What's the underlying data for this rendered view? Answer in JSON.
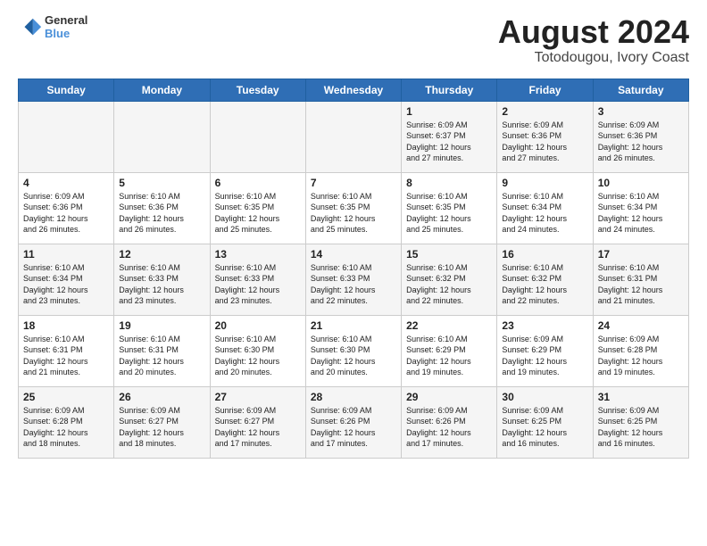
{
  "logo": {
    "line1": "General",
    "line2": "Blue"
  },
  "title": "August 2024",
  "subtitle": "Totodougou, Ivory Coast",
  "days_of_week": [
    "Sunday",
    "Monday",
    "Tuesday",
    "Wednesday",
    "Thursday",
    "Friday",
    "Saturday"
  ],
  "weeks": [
    [
      {
        "day": "",
        "info": ""
      },
      {
        "day": "",
        "info": ""
      },
      {
        "day": "",
        "info": ""
      },
      {
        "day": "",
        "info": ""
      },
      {
        "day": "1",
        "info": "Sunrise: 6:09 AM\nSunset: 6:37 PM\nDaylight: 12 hours\nand 27 minutes."
      },
      {
        "day": "2",
        "info": "Sunrise: 6:09 AM\nSunset: 6:36 PM\nDaylight: 12 hours\nand 27 minutes."
      },
      {
        "day": "3",
        "info": "Sunrise: 6:09 AM\nSunset: 6:36 PM\nDaylight: 12 hours\nand 26 minutes."
      }
    ],
    [
      {
        "day": "4",
        "info": "Sunrise: 6:09 AM\nSunset: 6:36 PM\nDaylight: 12 hours\nand 26 minutes."
      },
      {
        "day": "5",
        "info": "Sunrise: 6:10 AM\nSunset: 6:36 PM\nDaylight: 12 hours\nand 26 minutes."
      },
      {
        "day": "6",
        "info": "Sunrise: 6:10 AM\nSunset: 6:35 PM\nDaylight: 12 hours\nand 25 minutes."
      },
      {
        "day": "7",
        "info": "Sunrise: 6:10 AM\nSunset: 6:35 PM\nDaylight: 12 hours\nand 25 minutes."
      },
      {
        "day": "8",
        "info": "Sunrise: 6:10 AM\nSunset: 6:35 PM\nDaylight: 12 hours\nand 25 minutes."
      },
      {
        "day": "9",
        "info": "Sunrise: 6:10 AM\nSunset: 6:34 PM\nDaylight: 12 hours\nand 24 minutes."
      },
      {
        "day": "10",
        "info": "Sunrise: 6:10 AM\nSunset: 6:34 PM\nDaylight: 12 hours\nand 24 minutes."
      }
    ],
    [
      {
        "day": "11",
        "info": "Sunrise: 6:10 AM\nSunset: 6:34 PM\nDaylight: 12 hours\nand 23 minutes."
      },
      {
        "day": "12",
        "info": "Sunrise: 6:10 AM\nSunset: 6:33 PM\nDaylight: 12 hours\nand 23 minutes."
      },
      {
        "day": "13",
        "info": "Sunrise: 6:10 AM\nSunset: 6:33 PM\nDaylight: 12 hours\nand 23 minutes."
      },
      {
        "day": "14",
        "info": "Sunrise: 6:10 AM\nSunset: 6:33 PM\nDaylight: 12 hours\nand 22 minutes."
      },
      {
        "day": "15",
        "info": "Sunrise: 6:10 AM\nSunset: 6:32 PM\nDaylight: 12 hours\nand 22 minutes."
      },
      {
        "day": "16",
        "info": "Sunrise: 6:10 AM\nSunset: 6:32 PM\nDaylight: 12 hours\nand 22 minutes."
      },
      {
        "day": "17",
        "info": "Sunrise: 6:10 AM\nSunset: 6:31 PM\nDaylight: 12 hours\nand 21 minutes."
      }
    ],
    [
      {
        "day": "18",
        "info": "Sunrise: 6:10 AM\nSunset: 6:31 PM\nDaylight: 12 hours\nand 21 minutes."
      },
      {
        "day": "19",
        "info": "Sunrise: 6:10 AM\nSunset: 6:31 PM\nDaylight: 12 hours\nand 20 minutes."
      },
      {
        "day": "20",
        "info": "Sunrise: 6:10 AM\nSunset: 6:30 PM\nDaylight: 12 hours\nand 20 minutes."
      },
      {
        "day": "21",
        "info": "Sunrise: 6:10 AM\nSunset: 6:30 PM\nDaylight: 12 hours\nand 20 minutes."
      },
      {
        "day": "22",
        "info": "Sunrise: 6:10 AM\nSunset: 6:29 PM\nDaylight: 12 hours\nand 19 minutes."
      },
      {
        "day": "23",
        "info": "Sunrise: 6:09 AM\nSunset: 6:29 PM\nDaylight: 12 hours\nand 19 minutes."
      },
      {
        "day": "24",
        "info": "Sunrise: 6:09 AM\nSunset: 6:28 PM\nDaylight: 12 hours\nand 19 minutes."
      }
    ],
    [
      {
        "day": "25",
        "info": "Sunrise: 6:09 AM\nSunset: 6:28 PM\nDaylight: 12 hours\nand 18 minutes."
      },
      {
        "day": "26",
        "info": "Sunrise: 6:09 AM\nSunset: 6:27 PM\nDaylight: 12 hours\nand 18 minutes."
      },
      {
        "day": "27",
        "info": "Sunrise: 6:09 AM\nSunset: 6:27 PM\nDaylight: 12 hours\nand 17 minutes."
      },
      {
        "day": "28",
        "info": "Sunrise: 6:09 AM\nSunset: 6:26 PM\nDaylight: 12 hours\nand 17 minutes."
      },
      {
        "day": "29",
        "info": "Sunrise: 6:09 AM\nSunset: 6:26 PM\nDaylight: 12 hours\nand 17 minutes."
      },
      {
        "day": "30",
        "info": "Sunrise: 6:09 AM\nSunset: 6:25 PM\nDaylight: 12 hours\nand 16 minutes."
      },
      {
        "day": "31",
        "info": "Sunrise: 6:09 AM\nSunset: 6:25 PM\nDaylight: 12 hours\nand 16 minutes."
      }
    ]
  ]
}
